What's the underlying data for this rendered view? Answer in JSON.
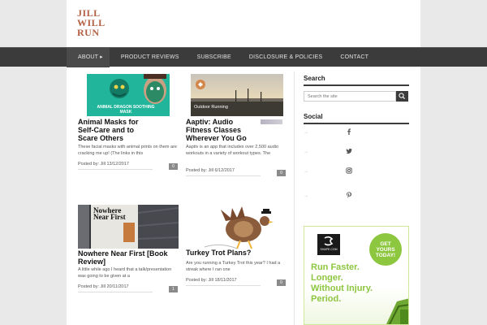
{
  "site": {
    "logo_lines": [
      "JILL",
      "WILL",
      "RUN"
    ]
  },
  "nav": {
    "items": [
      {
        "label": "ABOUT ▸",
        "active": true
      },
      {
        "label": "PRODUCT REVIEWS"
      },
      {
        "label": "SUBSCRIBE"
      },
      {
        "label": "DISCLOSURE & POLICIES"
      },
      {
        "label": "CONTACT"
      }
    ]
  },
  "posts": [
    {
      "title": "Animal Masks for Self-Care and to Scare Others",
      "excerpt": "These facial masks with animal prints on them are cracking me up! (The links in this",
      "meta": "Posted by: Jill 13/12/2017",
      "comments": "0",
      "image_caption": "ANIMAL DRAGON SOOTHING MASK"
    },
    {
      "title": "Aaptiv: Audio Fitness Classes Wherever You Go",
      "excerpt": "Aaptiv is an app that includes over 2,500 audio workouts in a variety of workout types. The",
      "meta": "Posted by: Jill 6/12/2017",
      "comments": "0",
      "image_caption": "Outdoor Running"
    },
    {
      "title": "Nowhere Near First [Book Review]",
      "excerpt": "A little while ago I heard that a talk/presentation was going to be given at a",
      "meta": "Posted by: Jill 20/11/2017",
      "comments": "1",
      "image_caption": "Nowhere Near First"
    },
    {
      "title": "Turkey Trot Plans?",
      "excerpt": "Are you running a Turkey Trot this year? I had a streak where I ran one",
      "meta": "Posted by: Jill 18/11/2017",
      "comments": "0"
    }
  ],
  "sidebar": {
    "search_title": "Search",
    "search_placeholder": "Search the site",
    "social_title": "Social",
    "social_icons": [
      "facebook-icon",
      "twitter-icon",
      "instagram-icon",
      "pinterest-icon"
    ],
    "ad": {
      "brand": "SHAPE.COM",
      "badge_lines": [
        "GET",
        "YOURS",
        "TODAY!"
      ],
      "tagline_lines": [
        "Run Faster.",
        "Longer.",
        "Without Injury.",
        "Period."
      ]
    }
  },
  "colors": {
    "nav_bg": "#3b3b3b",
    "logo": "#b25f42",
    "ad_green": "#8dc63f"
  }
}
